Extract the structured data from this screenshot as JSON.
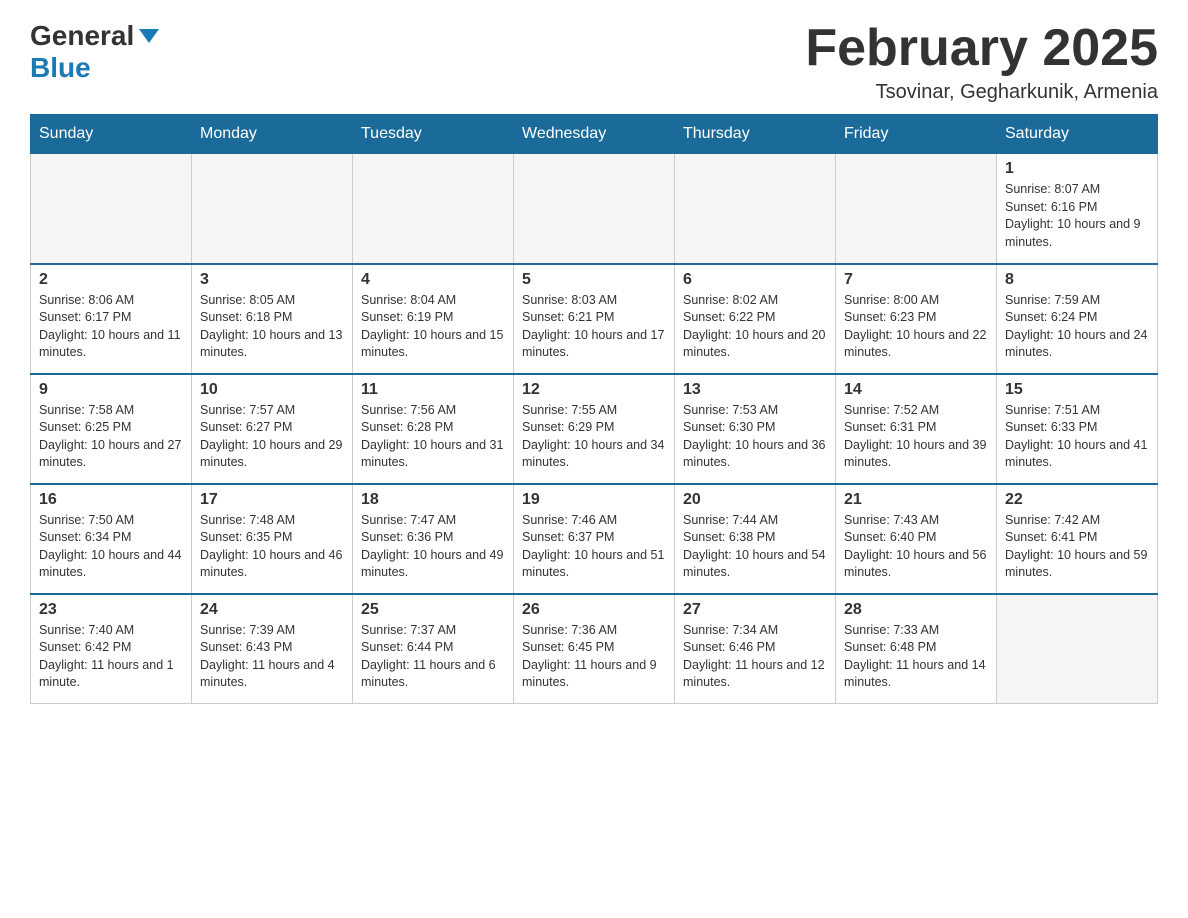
{
  "logo": {
    "general": "General",
    "blue": "Blue"
  },
  "header": {
    "title": "February 2025",
    "location": "Tsovinar, Gegharkunik, Armenia"
  },
  "days_of_week": [
    "Sunday",
    "Monday",
    "Tuesday",
    "Wednesday",
    "Thursday",
    "Friday",
    "Saturday"
  ],
  "weeks": [
    [
      {
        "day": "",
        "info": ""
      },
      {
        "day": "",
        "info": ""
      },
      {
        "day": "",
        "info": ""
      },
      {
        "day": "",
        "info": ""
      },
      {
        "day": "",
        "info": ""
      },
      {
        "day": "",
        "info": ""
      },
      {
        "day": "1",
        "info": "Sunrise: 8:07 AM\nSunset: 6:16 PM\nDaylight: 10 hours and 9 minutes."
      }
    ],
    [
      {
        "day": "2",
        "info": "Sunrise: 8:06 AM\nSunset: 6:17 PM\nDaylight: 10 hours and 11 minutes."
      },
      {
        "day": "3",
        "info": "Sunrise: 8:05 AM\nSunset: 6:18 PM\nDaylight: 10 hours and 13 minutes."
      },
      {
        "day": "4",
        "info": "Sunrise: 8:04 AM\nSunset: 6:19 PM\nDaylight: 10 hours and 15 minutes."
      },
      {
        "day": "5",
        "info": "Sunrise: 8:03 AM\nSunset: 6:21 PM\nDaylight: 10 hours and 17 minutes."
      },
      {
        "day": "6",
        "info": "Sunrise: 8:02 AM\nSunset: 6:22 PM\nDaylight: 10 hours and 20 minutes."
      },
      {
        "day": "7",
        "info": "Sunrise: 8:00 AM\nSunset: 6:23 PM\nDaylight: 10 hours and 22 minutes."
      },
      {
        "day": "8",
        "info": "Sunrise: 7:59 AM\nSunset: 6:24 PM\nDaylight: 10 hours and 24 minutes."
      }
    ],
    [
      {
        "day": "9",
        "info": "Sunrise: 7:58 AM\nSunset: 6:25 PM\nDaylight: 10 hours and 27 minutes."
      },
      {
        "day": "10",
        "info": "Sunrise: 7:57 AM\nSunset: 6:27 PM\nDaylight: 10 hours and 29 minutes."
      },
      {
        "day": "11",
        "info": "Sunrise: 7:56 AM\nSunset: 6:28 PM\nDaylight: 10 hours and 31 minutes."
      },
      {
        "day": "12",
        "info": "Sunrise: 7:55 AM\nSunset: 6:29 PM\nDaylight: 10 hours and 34 minutes."
      },
      {
        "day": "13",
        "info": "Sunrise: 7:53 AM\nSunset: 6:30 PM\nDaylight: 10 hours and 36 minutes."
      },
      {
        "day": "14",
        "info": "Sunrise: 7:52 AM\nSunset: 6:31 PM\nDaylight: 10 hours and 39 minutes."
      },
      {
        "day": "15",
        "info": "Sunrise: 7:51 AM\nSunset: 6:33 PM\nDaylight: 10 hours and 41 minutes."
      }
    ],
    [
      {
        "day": "16",
        "info": "Sunrise: 7:50 AM\nSunset: 6:34 PM\nDaylight: 10 hours and 44 minutes."
      },
      {
        "day": "17",
        "info": "Sunrise: 7:48 AM\nSunset: 6:35 PM\nDaylight: 10 hours and 46 minutes."
      },
      {
        "day": "18",
        "info": "Sunrise: 7:47 AM\nSunset: 6:36 PM\nDaylight: 10 hours and 49 minutes."
      },
      {
        "day": "19",
        "info": "Sunrise: 7:46 AM\nSunset: 6:37 PM\nDaylight: 10 hours and 51 minutes."
      },
      {
        "day": "20",
        "info": "Sunrise: 7:44 AM\nSunset: 6:38 PM\nDaylight: 10 hours and 54 minutes."
      },
      {
        "day": "21",
        "info": "Sunrise: 7:43 AM\nSunset: 6:40 PM\nDaylight: 10 hours and 56 minutes."
      },
      {
        "day": "22",
        "info": "Sunrise: 7:42 AM\nSunset: 6:41 PM\nDaylight: 10 hours and 59 minutes."
      }
    ],
    [
      {
        "day": "23",
        "info": "Sunrise: 7:40 AM\nSunset: 6:42 PM\nDaylight: 11 hours and 1 minute."
      },
      {
        "day": "24",
        "info": "Sunrise: 7:39 AM\nSunset: 6:43 PM\nDaylight: 11 hours and 4 minutes."
      },
      {
        "day": "25",
        "info": "Sunrise: 7:37 AM\nSunset: 6:44 PM\nDaylight: 11 hours and 6 minutes."
      },
      {
        "day": "26",
        "info": "Sunrise: 7:36 AM\nSunset: 6:45 PM\nDaylight: 11 hours and 9 minutes."
      },
      {
        "day": "27",
        "info": "Sunrise: 7:34 AM\nSunset: 6:46 PM\nDaylight: 11 hours and 12 minutes."
      },
      {
        "day": "28",
        "info": "Sunrise: 7:33 AM\nSunset: 6:48 PM\nDaylight: 11 hours and 14 minutes."
      },
      {
        "day": "",
        "info": ""
      }
    ]
  ]
}
